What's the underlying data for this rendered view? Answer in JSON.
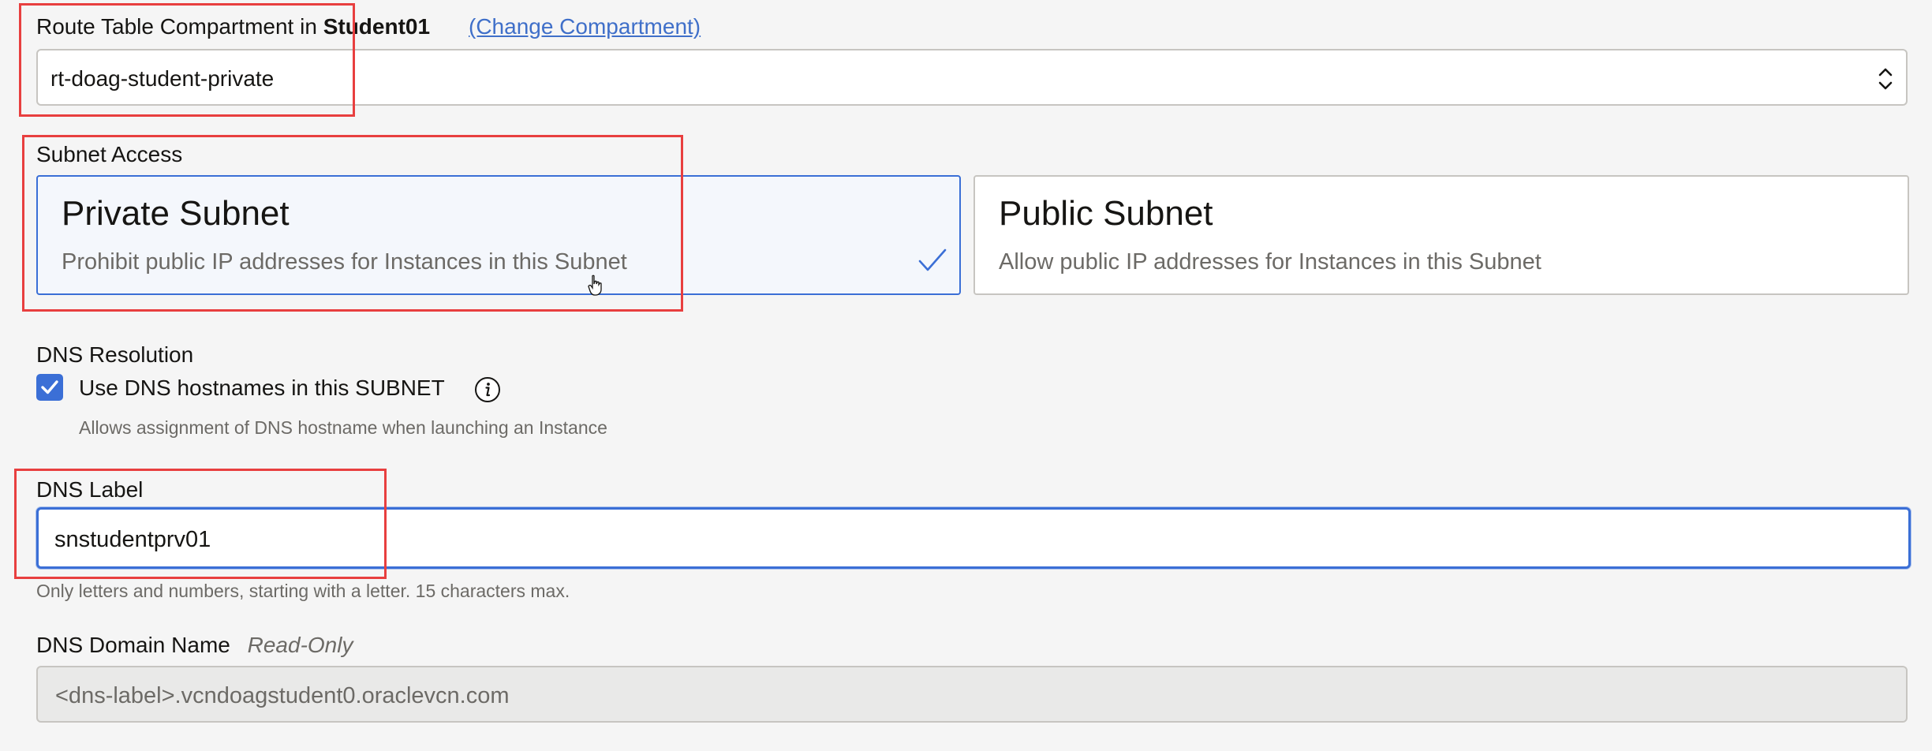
{
  "route_table": {
    "label_prefix": "Route Table Compartment in",
    "compartment": "Student01",
    "change_link": "(Change Compartment)",
    "selected_value": "rt-doag-student-private",
    "arrows_icon": "updown-chevron-icon"
  },
  "subnet_access": {
    "label": "Subnet Access",
    "options": [
      {
        "title": "Private Subnet",
        "description": "Prohibit public IP addresses for Instances in this Subnet",
        "selected": true
      },
      {
        "title": "Public Subnet",
        "description": "Allow public IP addresses for Instances in this Subnet",
        "selected": false
      }
    ]
  },
  "dns_resolution": {
    "label": "DNS Resolution",
    "checkbox_label": "Use DNS hostnames in this SUBNET",
    "checked": true,
    "help": "Allows assignment of DNS hostname when launching an Instance"
  },
  "dns_label": {
    "label": "DNS Label",
    "value": "snstudentprv01",
    "hint": "Only letters and numbers, starting with a letter. 15 characters max."
  },
  "dns_domain": {
    "label": "DNS Domain Name",
    "tag": "Read-Only",
    "value": "<dns-label>.vcndoagstudent0.oraclevcn.com"
  },
  "colors": {
    "accent": "#3b6fd6",
    "link": "#3f6fc9",
    "annotation": "#e83f3f",
    "page_bg": "#f5f5f5"
  }
}
